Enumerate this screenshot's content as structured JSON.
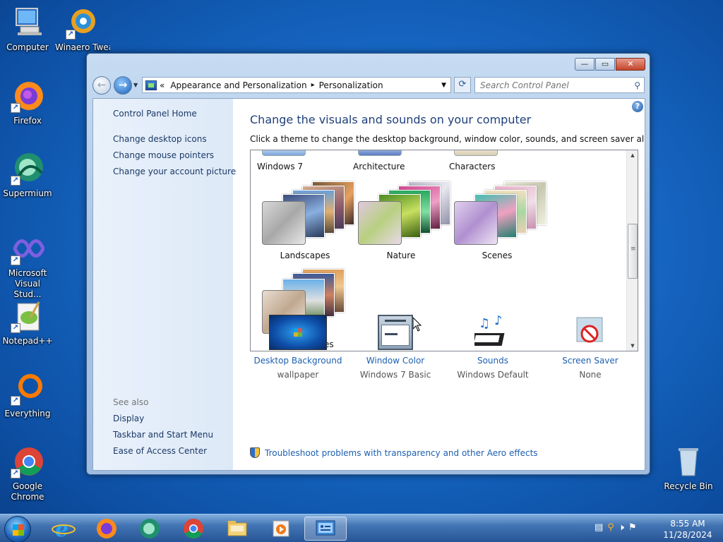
{
  "desktop": {
    "icons": [
      {
        "label": "Computer"
      },
      {
        "label": "Winaero Twea..."
      },
      {
        "label": "Firefox"
      },
      {
        "label": "Supermium"
      },
      {
        "label": "Microsoft Visual Stud..."
      },
      {
        "label": "Notepad++"
      },
      {
        "label": "Everything"
      },
      {
        "label": "Google Chrome"
      },
      {
        "label": "Recycle Bin"
      }
    ]
  },
  "window": {
    "controls": {
      "minimize": "—",
      "maximize": "▭",
      "close": "✕"
    },
    "address": {
      "chevron": "«",
      "crumbs": [
        "Appearance and Personalization",
        "Personalization"
      ],
      "separator": "▸"
    },
    "search": {
      "placeholder": "Search Control Panel"
    },
    "sidebar": {
      "home": "Control Panel Home",
      "links": [
        "Change desktop icons",
        "Change mouse pointers",
        "Change your account picture"
      ],
      "see_also_header": "See also",
      "see_also": [
        "Display",
        "Taskbar and Start Menu",
        "Ease of Access Center"
      ]
    },
    "main": {
      "title": "Change the visuals and sounds on your computer",
      "subtitle": "Click a theme to change the desktop background, window color, sounds, and screen saver all at once.",
      "help": "?",
      "themes_row_top": [
        "Windows 7",
        "Architecture",
        "Characters"
      ],
      "themes": [
        "Landscapes",
        "Nature",
        "Scenes",
        "United States"
      ],
      "bottom": [
        {
          "label": "Desktop Background",
          "sub": "wallpaper"
        },
        {
          "label": "Window Color",
          "sub": "Windows 7 Basic"
        },
        {
          "label": "Sounds",
          "sub": "Windows Default"
        },
        {
          "label": "Screen Saver",
          "sub": "None"
        }
      ],
      "troubleshoot": "Troubleshoot problems with transparency and other Aero effects"
    }
  },
  "taskbar": {
    "time": "8:55 AM",
    "date": "11/28/2024"
  }
}
